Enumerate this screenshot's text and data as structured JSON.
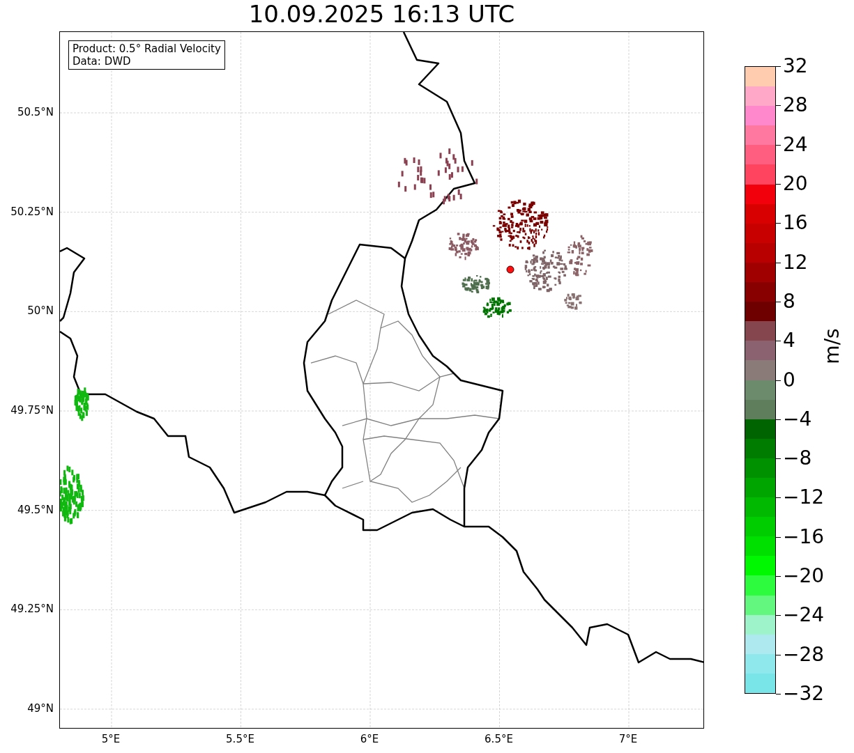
{
  "title": "10.09.2025 16:13 UTC",
  "legend": {
    "lines": [
      "Product: 0.5° Radial Velocity",
      "Data: DWD"
    ]
  },
  "map": {
    "y_ticks": [
      "50.5°N",
      "50.25°N",
      "50°N",
      "49.75°N",
      "49.5°N",
      "49.25°N",
      "49°N"
    ],
    "x_ticks": [
      "5°E",
      "5.5°E",
      "6°E",
      "6.5°E",
      "7°E"
    ]
  },
  "colorbar": {
    "label": "m/s",
    "ticks": [
      "32",
      "28",
      "24",
      "20",
      "16",
      "12",
      "8",
      "4",
      "0",
      "−4",
      "−8",
      "−12",
      "−16",
      "−20",
      "−24",
      "−28",
      "−32"
    ],
    "bins": [
      {
        "color": "#79e5e8"
      },
      {
        "color": "#8fe9ec"
      },
      {
        "color": "#ade9ef"
      },
      {
        "color": "#9ef3cb"
      },
      {
        "color": "#63f77f"
      },
      {
        "color": "#2dfb3e"
      },
      {
        "color": "#00f800"
      },
      {
        "color": "#00e000"
      },
      {
        "color": "#00cd00"
      },
      {
        "color": "#00b900"
      },
      {
        "color": "#00a500"
      },
      {
        "color": "#009100"
      },
      {
        "color": "#007d00"
      },
      {
        "color": "#006400"
      },
      {
        "color": "#5e7e5c"
      },
      {
        "color": "#6c8a6c"
      },
      {
        "color": "#8a7a78"
      },
      {
        "color": "#8a6270"
      },
      {
        "color": "#86464e"
      },
      {
        "color": "#6e0000"
      },
      {
        "color": "#880000"
      },
      {
        "color": "#a00000"
      },
      {
        "color": "#b80000"
      },
      {
        "color": "#c80000"
      },
      {
        "color": "#d80000"
      },
      {
        "color": "#f2000c"
      },
      {
        "color": "#ff4460"
      },
      {
        "color": "#ff5e80"
      },
      {
        "color": "#ff78a0"
      },
      {
        "color": "#ff88cc"
      },
      {
        "color": "#ffa8c8"
      },
      {
        "color": "#ffccb0"
      }
    ]
  }
}
